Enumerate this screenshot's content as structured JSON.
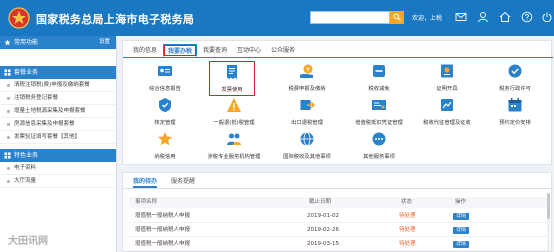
{
  "header": {
    "site_title": "国家税务总局上海市电子税务局",
    "search_placeholder": "",
    "welcome": "欢迎，上税"
  },
  "sidebar": {
    "common_functions": "常用功能",
    "settings": "设置",
    "tax_section": "套餐业务",
    "items": [
      "清税注销税(费)申报及缴纳套餐",
      "注销税务登记套餐",
      "增量土地税源采集及申报套餐",
      "房源信息采集及申报套餐",
      "发票验证填写套餐【其他】"
    ],
    "special_section": "特色业务",
    "special_items": [
      "电子资料",
      "大厅流量"
    ]
  },
  "tabs": [
    "我的信息",
    "我要办税",
    "我要查询",
    "互动中心",
    "公众服务"
  ],
  "icons": [
    {
      "label": "综合信息报告",
      "icon": "id-card-icon"
    },
    {
      "label": "发票使用",
      "icon": "invoice-icon"
    },
    {
      "label": "税费申报及缴纳",
      "icon": "tax-payment-icon"
    },
    {
      "label": "税收减免",
      "icon": "tax-relief-icon"
    },
    {
      "label": "证明开具",
      "icon": "certificate-icon"
    },
    {
      "label": "税务行政许可",
      "icon": "permit-icon"
    },
    {
      "label": "核定管理",
      "icon": "approval-icon"
    },
    {
      "label": "一般退(抵)税管理",
      "icon": "refund-icon"
    },
    {
      "label": "出口退税管理",
      "icon": "export-icon"
    },
    {
      "label": "增值税抵扣凭证管理",
      "icon": "voucher-icon"
    },
    {
      "label": "税收代征管理及征收",
      "icon": "levy-icon"
    },
    {
      "label": "预约定价安排",
      "icon": "calendar-icon"
    },
    {
      "label": "纳税信用",
      "icon": "credit-icon"
    },
    {
      "label": "涉税专业服务机构管理",
      "icon": "agency-icon"
    },
    {
      "label": "国际税收及其他事项",
      "icon": "globe-icon"
    },
    {
      "label": "其他服务事项",
      "icon": "service-icon"
    }
  ],
  "todo": {
    "tabs": [
      "我的待办",
      "服务提醒"
    ],
    "columns": [
      "事项名称",
      "截止日期",
      "状态",
      "操作"
    ],
    "rows": [
      {
        "name": "增值税一般纳税人申报",
        "date": "2019-01-02",
        "status": "待处理",
        "action": "详情"
      },
      {
        "name": "增值税一般纳税人申报",
        "date": "2019-02-26",
        "status": "待处理",
        "action": "详情"
      },
      {
        "name": "增值税一般纳税人申报",
        "date": "2019-03-15",
        "status": "待处理",
        "action": "详情"
      }
    ]
  },
  "watermark": "大田讯网",
  "colors": {
    "header": "#1a78c2",
    "accent": "#2b82cc",
    "highlight": "#e02020",
    "pending": "#e8612c"
  }
}
